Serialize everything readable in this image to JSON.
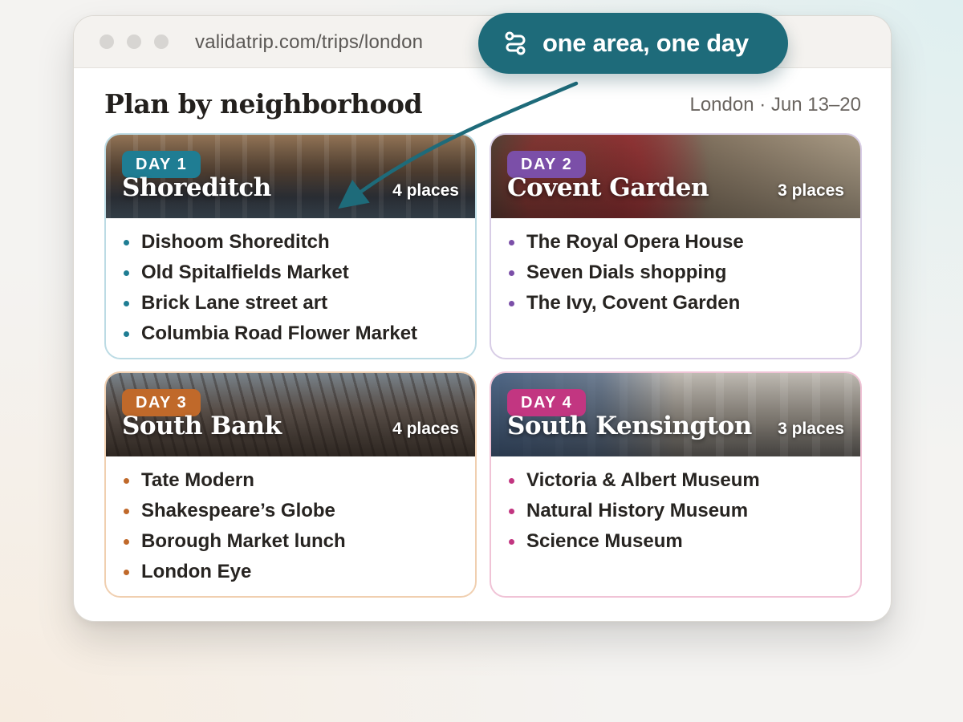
{
  "browser": {
    "url": "validatrip.com/trips/london"
  },
  "page": {
    "title": "Plan by neighborhood",
    "subtitle": "London · Jun 13–20"
  },
  "callout": {
    "text": "one area, one day",
    "icon": "route-icon"
  },
  "days": [
    {
      "badge": "DAY 1",
      "area": "Shoreditch",
      "count": "4 places",
      "color": "#1f7d93",
      "border": "#bcdbe4",
      "places": [
        "Dishoom Shoreditch",
        "Old Spitalfields Market",
        "Brick Lane street art",
        "Columbia Road Flower Market"
      ]
    },
    {
      "badge": "DAY 2",
      "area": "Covent Garden",
      "count": "3 places",
      "color": "#7b4fa8",
      "border": "#d8cde6",
      "places": [
        "The Royal Opera House",
        "Seven Dials shopping",
        "The Ivy, Covent Garden"
      ]
    },
    {
      "badge": "DAY 3",
      "area": "South Bank",
      "count": "4 places",
      "color": "#c0692a",
      "border": "#f0cfb0",
      "places": [
        "Tate Modern",
        "Shakespeare’s Globe",
        "Borough Market lunch",
        "London Eye"
      ]
    },
    {
      "badge": "DAY 4",
      "area": "South Kensington",
      "count": "3 places",
      "color": "#c23681",
      "border": "#f0c3d6",
      "places": [
        "Victoria & Albert Museum",
        "Natural History Museum",
        "Science Museum"
      ]
    }
  ]
}
